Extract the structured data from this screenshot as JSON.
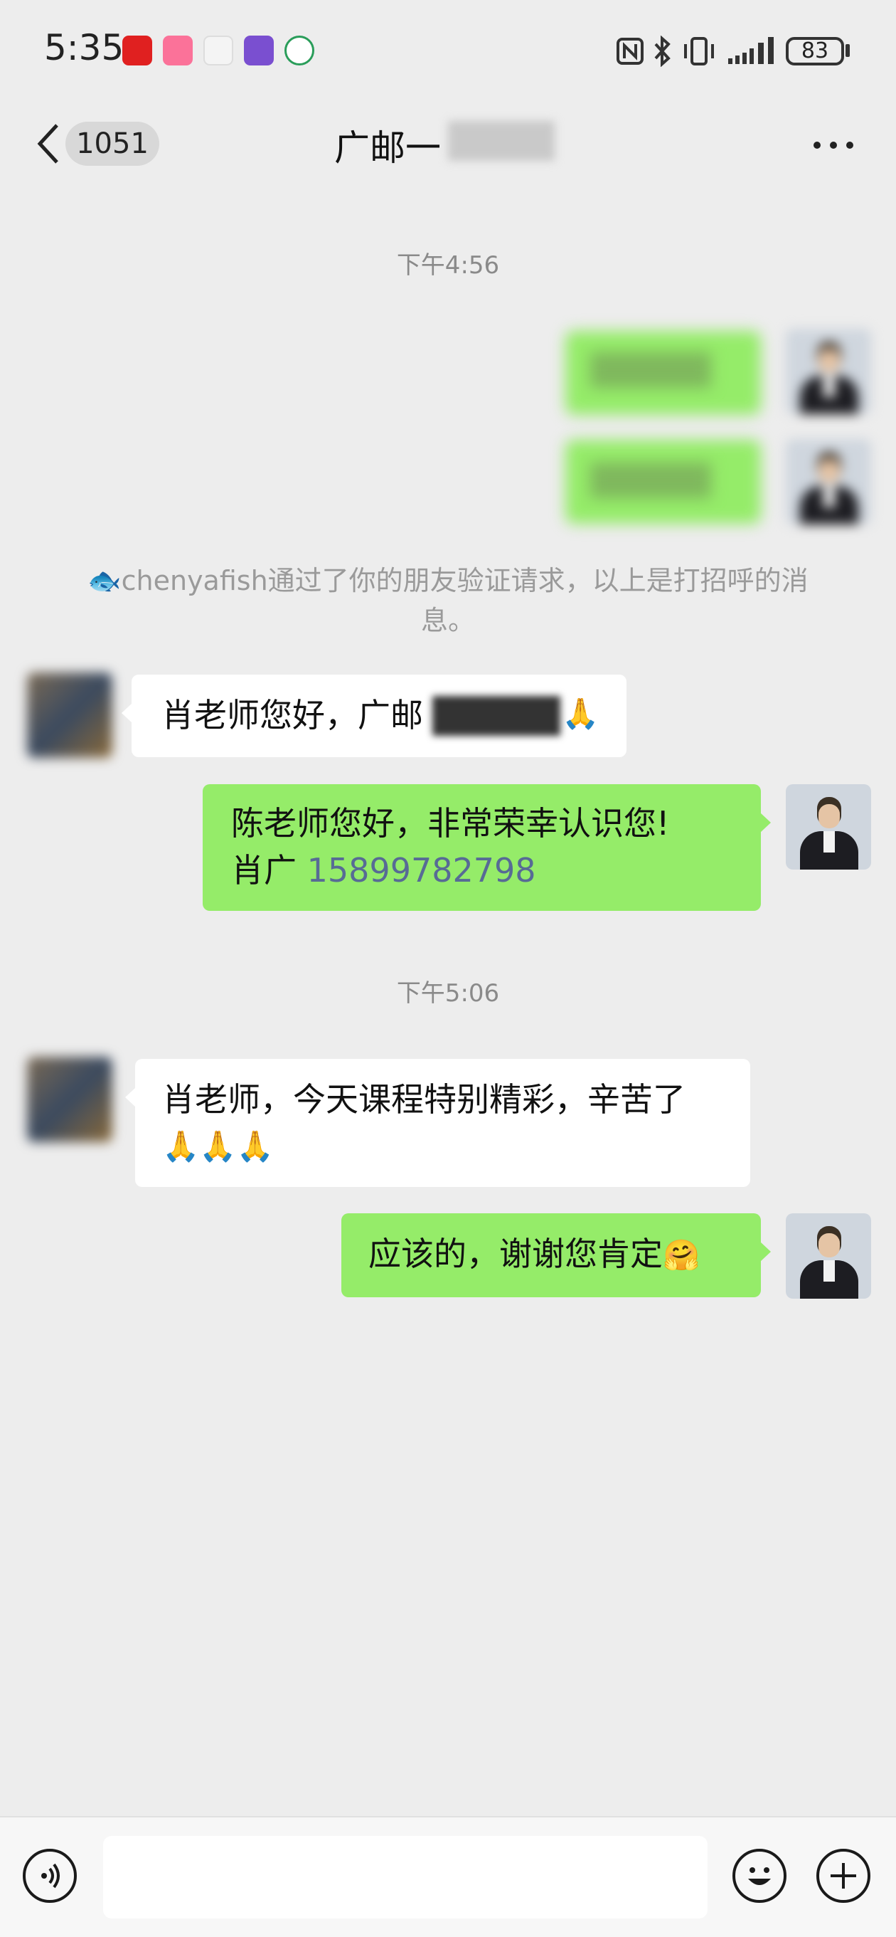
{
  "status_bar": {
    "time": "5:35",
    "battery": "83",
    "app_icons": [
      {
        "name": "pinduoduo-icon",
        "color": "#e02020"
      },
      {
        "name": "bilibili-icon",
        "color": "#fb7299"
      },
      {
        "name": "calendar-app-icon",
        "color": "#f4f4f4"
      },
      {
        "name": "game-app-icon",
        "color": "#7a4fd0"
      },
      {
        "name": "china-mobile-icon",
        "color": "#ffffff"
      }
    ],
    "indicators": [
      "nfc-icon",
      "bluetooth-icon",
      "vibrate-icon",
      "signal-icon"
    ]
  },
  "header": {
    "unread_count": "1051",
    "title": "广邮一"
  },
  "colors": {
    "background": "#ededed",
    "bubble_me": "#95ec69",
    "bubble_other": "#ffffff",
    "link": "#576b95"
  },
  "messages": {
    "timestamp_1": "下午4:56",
    "system_notice": "🐟chenyafish通过了你的朋友验证请求，以上是打招呼的消息。",
    "incoming_1": "肖老师您好，广邮",
    "incoming_1_emoji": "🙏",
    "outgoing_1_line1": "陈老师您好，非常荣幸认识您!",
    "outgoing_1_name": "肖广",
    "outgoing_1_phone": "15899782798",
    "timestamp_2": "下午5:06",
    "incoming_2": "肖老师，今天课程特别精彩，辛苦了",
    "incoming_2_emoji": "🙏🙏🙏",
    "outgoing_2": "应该的，谢谢您肯定",
    "outgoing_2_emoji": "🤗"
  },
  "input_bar": {
    "placeholder": "",
    "icons": [
      "voice-icon",
      "emoji-icon",
      "plus-icon"
    ]
  }
}
